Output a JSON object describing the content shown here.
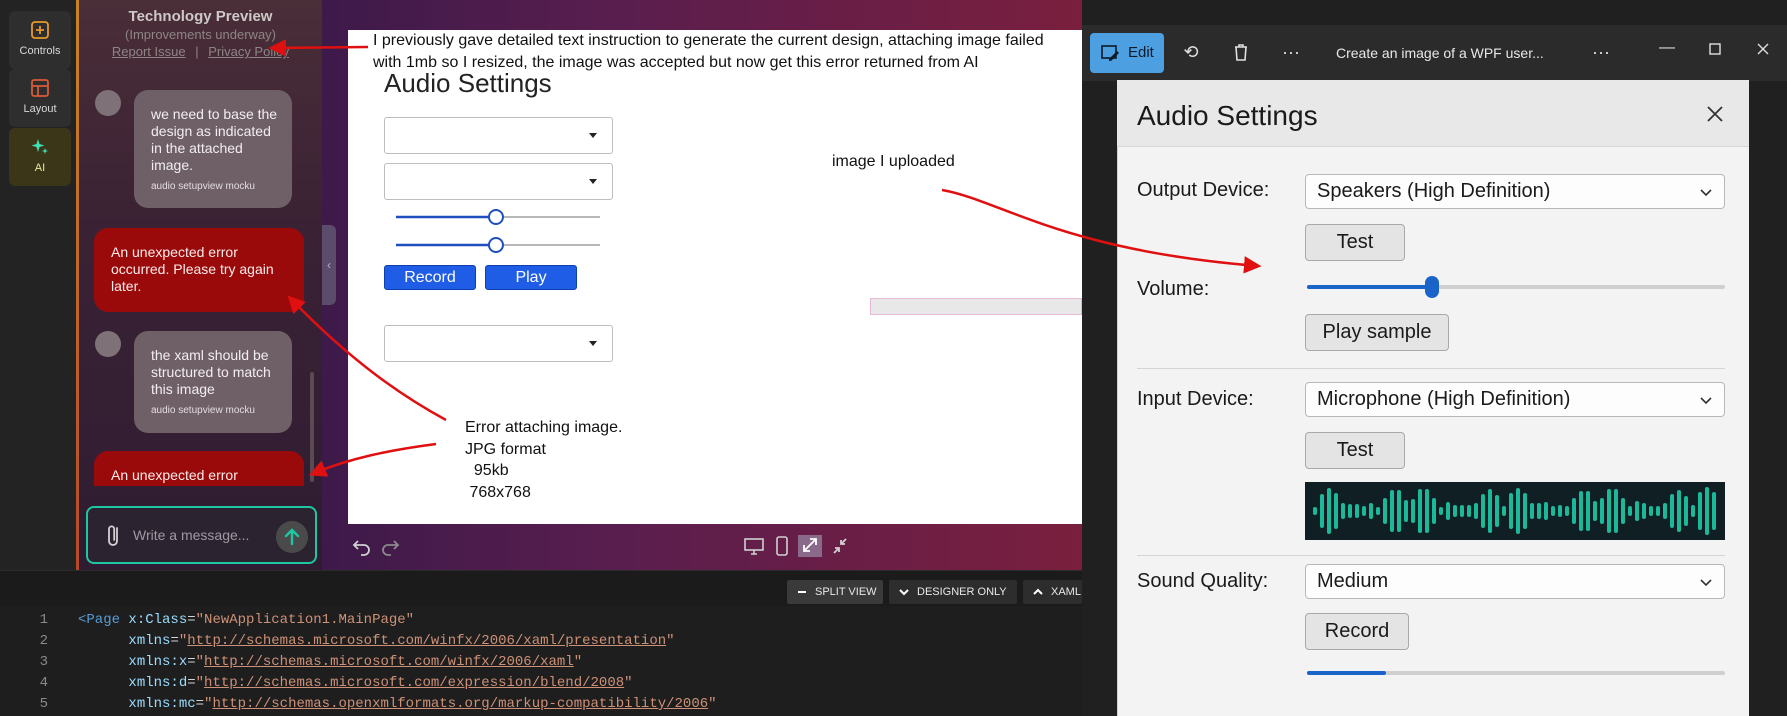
{
  "rail": {
    "controls": "Controls",
    "layout": "Layout",
    "ai": "AI"
  },
  "chat": {
    "title": "Technology Preview",
    "subtitle": "(Improvements underway)",
    "report": "Report Issue",
    "sep": "|",
    "privacy": "Privacy Policy",
    "messages": [
      {
        "role": "user",
        "text": "we need to base the design as indicated in the attached image.",
        "attachment": "audio setupview mocku"
      },
      {
        "role": "error",
        "text": "An unexpected error occurred. Please try again later."
      },
      {
        "role": "user",
        "text": "the xaml should be structured to match this image",
        "attachment": "audio setupview mocku"
      },
      {
        "role": "error",
        "text": "An unexpected error"
      }
    ],
    "input_placeholder": "Write a message..."
  },
  "designer": {
    "canvas_title": "Audio Settings",
    "record": "Record",
    "play": "Play",
    "sliders": [
      0.49,
      0.49
    ]
  },
  "annotations": {
    "top": [
      "I previously gave detailed text instruction to generate the current design, attaching image failed",
      "with 1mb so I resized, the image was accepted but now get this error returned from AI"
    ],
    "uploaded": "image I uploaded",
    "error_lines": [
      "Error attaching image.",
      "JPG format",
      "  95kb",
      " 768x768"
    ]
  },
  "split_bar": {
    "split": "SPLIT VIEW",
    "designer_only": "DESIGNER ONLY",
    "xaml": "XAML"
  },
  "code": [
    {
      "n": "1",
      "indent": "",
      "parts": [
        [
          "tag",
          "<Page"
        ],
        [
          "punct",
          " "
        ],
        [
          "attr",
          "x:Class"
        ],
        [
          "punct",
          "="
        ],
        [
          "str",
          "\"NewApplication1.MainPage\""
        ]
      ]
    },
    {
      "n": "2",
      "indent": "      ",
      "parts": [
        [
          "attr",
          "xmlns"
        ],
        [
          "punct",
          "="
        ],
        [
          "str",
          "\""
        ],
        [
          "url",
          "http://schemas.microsoft.com/winfx/2006/xaml/presentation"
        ],
        [
          "str",
          "\""
        ]
      ]
    },
    {
      "n": "3",
      "indent": "      ",
      "parts": [
        [
          "attr",
          "xmlns:x"
        ],
        [
          "punct",
          "="
        ],
        [
          "str",
          "\""
        ],
        [
          "url",
          "http://schemas.microsoft.com/winfx/2006/xaml"
        ],
        [
          "str",
          "\""
        ]
      ]
    },
    {
      "n": "4",
      "indent": "      ",
      "parts": [
        [
          "attr",
          "xmlns:d"
        ],
        [
          "punct",
          "="
        ],
        [
          "str",
          "\""
        ],
        [
          "url",
          "http://schemas.microsoft.com/expression/blend/2008"
        ],
        [
          "str",
          "\""
        ]
      ]
    },
    {
      "n": "5",
      "indent": "      ",
      "parts": [
        [
          "attr",
          "xmlns:mc"
        ],
        [
          "punct",
          "="
        ],
        [
          "str",
          "\""
        ],
        [
          "url",
          "http://schemas.openxmlformats.org/markup-compatibility/2006"
        ],
        [
          "str",
          "\""
        ]
      ]
    }
  ],
  "viewer": {
    "edit": "Edit",
    "title": "Create an image of a WPF user...",
    "more": "···"
  },
  "app": {
    "title": "Audio Settings",
    "output_label": "Output Device:",
    "output_value": "Speakers (High Definition)",
    "test": "Test",
    "volume_label": "Volume:",
    "volume": 0.3,
    "play_sample": "Play sample",
    "input_label": "Input Device:",
    "input_value": "Microphone (High Definition)",
    "input_test": "Test",
    "quality_label": "Sound Quality:",
    "quality_value": "Medium",
    "record": "Record",
    "record_progress": 0.19
  },
  "colors": {
    "accent_blue": "#1a63c9",
    "error_red": "#9b0a0a",
    "teal": "#1dc7a4",
    "annotation_red": "#e01010"
  }
}
